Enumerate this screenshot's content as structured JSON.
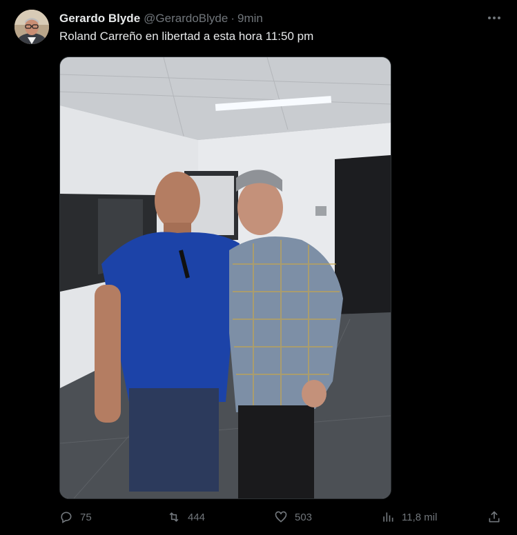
{
  "tweet": {
    "author_name": "Gerardo Blyde",
    "author_handle": "@GerardoBlyde",
    "separator": "·",
    "time": "9min",
    "text": "Roland Carreño en libertad a esta hora 11:50 pm"
  },
  "actions": {
    "replies": "75",
    "reposts": "444",
    "likes": "503",
    "views": "11,8 mil"
  },
  "icons": {
    "more": "more-horizontal-icon",
    "reply": "reply-icon",
    "repost": "repost-icon",
    "like": "heart-icon",
    "views": "analytics-icon",
    "share": "share-icon"
  },
  "colors": {
    "background": "#000000",
    "text": "#e7e9ea",
    "muted": "#71767b"
  }
}
